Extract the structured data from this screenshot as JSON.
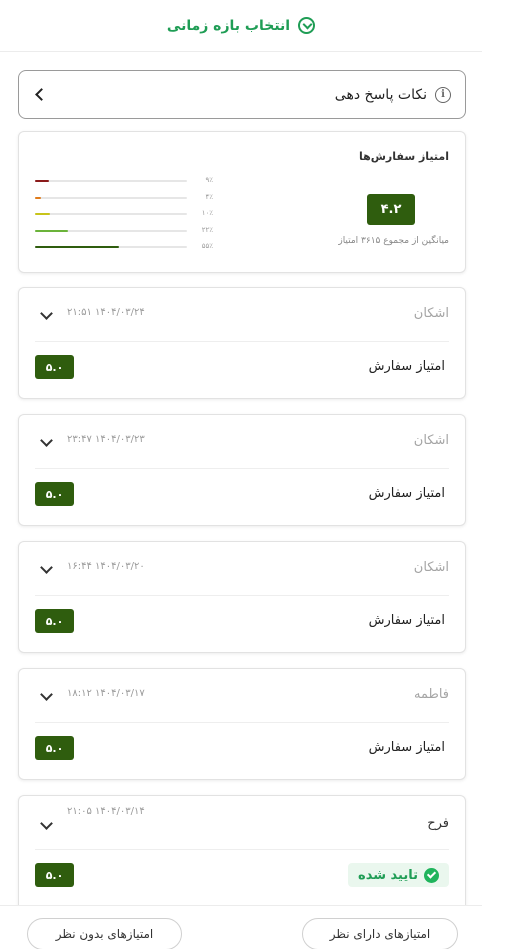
{
  "header": {
    "title": "انتخاب بازه زمانی"
  },
  "tips": {
    "label": "نکات پاسخ دهی"
  },
  "summary": {
    "title": "امتیاز سفارش‌ها",
    "score": "۴.۲",
    "avg_text": "میانگین از مجموع ۳۶۱۵ امتیاز",
    "bars": [
      {
        "pct_label": "۹٪",
        "value": 0.09,
        "color": "#8b1a1a"
      },
      {
        "pct_label": "۴٪",
        "value": 0.04,
        "color": "#e07b1a"
      },
      {
        "pct_label": "۱۰٪",
        "value": 0.1,
        "color": "#c8c41a"
      },
      {
        "pct_label": "۲۲٪",
        "value": 0.22,
        "color": "#6bb33a"
      },
      {
        "pct_label": "۵۵٪",
        "value": 0.55,
        "color": "#2f5d0e"
      }
    ]
  },
  "reviews": [
    {
      "name": "اشکان",
      "date": "۲۱:۵۱ ۱۴۰۴/۰۳/۲۴",
      "rating_label": "امتیاز سفارش",
      "score": "۵.۰"
    },
    {
      "name": "اشکان",
      "date": "۲۳:۴۷ ۱۴۰۴/۰۳/۲۳",
      "rating_label": "امتیاز سفارش",
      "score": "۵.۰"
    },
    {
      "name": "اشکان",
      "date": "۱۶:۴۴ ۱۴۰۴/۰۳/۲۰",
      "rating_label": "امتیاز سفارش",
      "score": "۵.۰"
    },
    {
      "name": "فاطمه",
      "date": "۱۸:۱۲ ۱۴۰۴/۰۳/۱۷",
      "rating_label": "امتیاز سفارش",
      "score": "۵.۰"
    },
    {
      "name": "فرح",
      "date": "۲۱:۰۵ ۱۴۰۴/۰۳/۱۴",
      "status": "تایید شده",
      "score": "۵.۰"
    }
  ],
  "bottom": {
    "with_comment": "امتیازهای دارای نظر",
    "without_comment": "امتیازهای بدون نظر"
  },
  "colors": {
    "accent": "#1f9d55",
    "score_bg": "#2f5d0e"
  }
}
